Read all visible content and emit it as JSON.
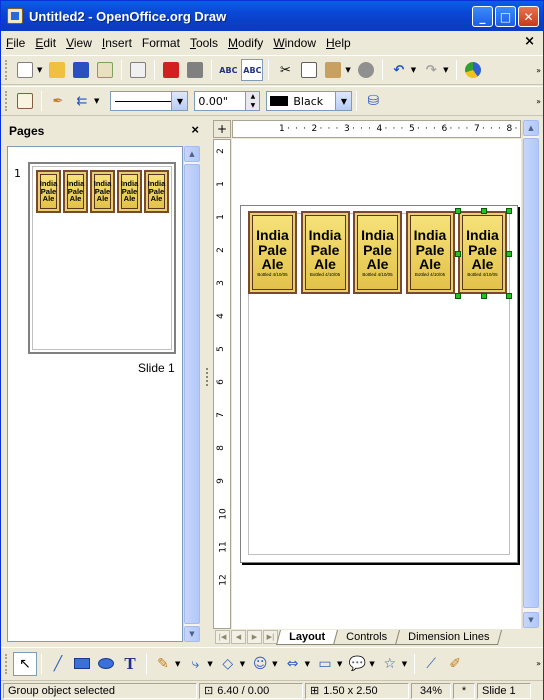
{
  "window": {
    "title": "Untitled2 - OpenOffice.org Draw",
    "minimize_icon": "minimize-icon",
    "maximize_icon": "maximize-icon",
    "close_icon": "close-icon"
  },
  "menubar": {
    "items": [
      {
        "label": "File",
        "ul": "F",
        "rest": "ile"
      },
      {
        "label": "Edit",
        "ul": "E",
        "rest": "dit"
      },
      {
        "label": "View",
        "ul": "V",
        "rest": "iew"
      },
      {
        "label": "Insert",
        "ul": "I",
        "rest": "nsert"
      },
      {
        "label": "Format",
        "ul": "F",
        "rest": "ormat"
      },
      {
        "label": "Tools",
        "ul": "T",
        "rest": "ools"
      },
      {
        "label": "Modify",
        "ul": "M",
        "rest": "odify"
      },
      {
        "label": "Window",
        "ul": "W",
        "rest": "indow"
      },
      {
        "label": "Help",
        "ul": "H",
        "rest": "elp"
      }
    ],
    "close_doc": "×"
  },
  "line_toolbar": {
    "line_width": "0.00\"",
    "line_color": "Black",
    "line_color_hex": "#000000"
  },
  "pages_pane": {
    "title": "Pages",
    "close": "×",
    "slide_number": "1",
    "slide_name": "Slide 1"
  },
  "labels": {
    "line1": "India",
    "line2": "Pale",
    "line3": "Ale",
    "bottled": "Bottled 4/10/05",
    "count": 5,
    "fill_hex": "#f0d85a",
    "border_hex": "#7a4a30"
  },
  "hruler": {
    "ticks": [
      "1",
      "2",
      "3",
      "4",
      "5",
      "6",
      "7",
      "8"
    ]
  },
  "vruler": {
    "ticks": [
      "2",
      "1",
      "1",
      "2",
      "3",
      "4",
      "5",
      "6",
      "7",
      "8",
      "9",
      "10",
      "11",
      "12"
    ]
  },
  "tabs": [
    {
      "label": "Layout",
      "active": true
    },
    {
      "label": "Controls",
      "active": false
    },
    {
      "label": "Dimension Lines",
      "active": false
    }
  ],
  "statusbar": {
    "message": "Group object selected",
    "position": "6.40 / 0.00",
    "size": "1.50 x 2.50",
    "zoom": "34%",
    "modified": "*",
    "slide": "Slide 1"
  }
}
